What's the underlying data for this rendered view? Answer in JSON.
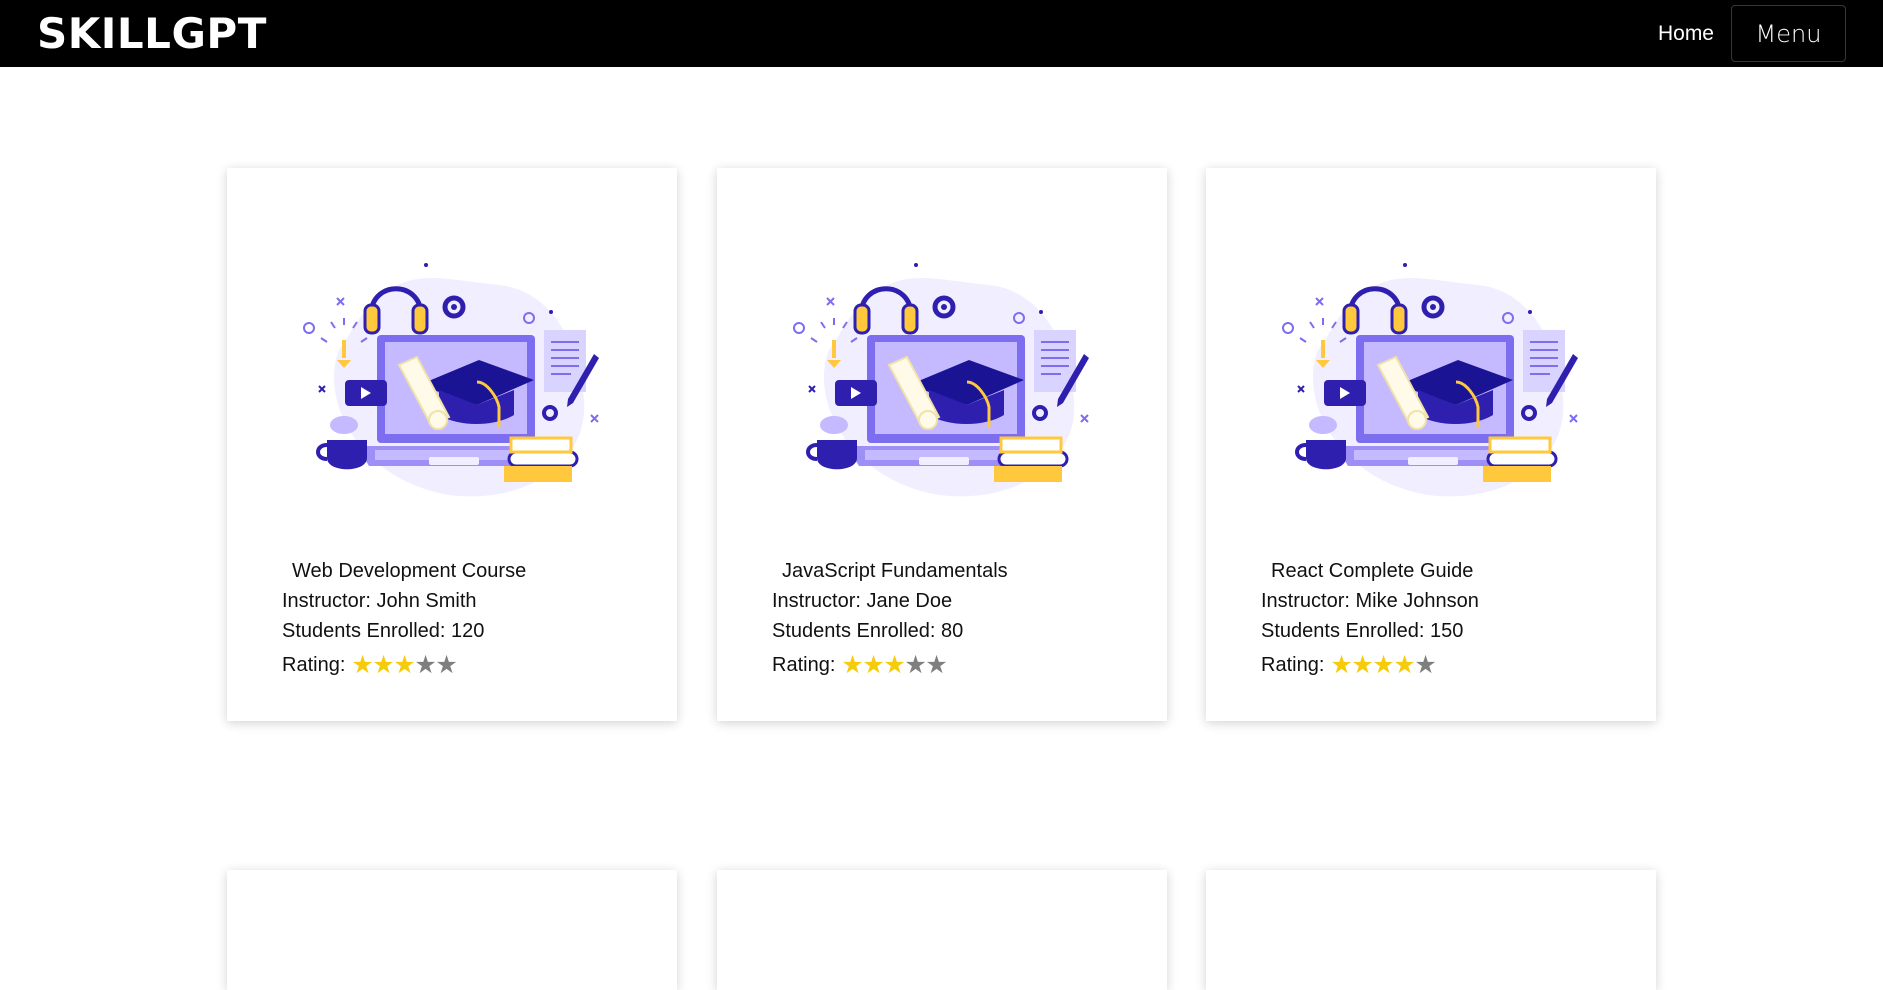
{
  "header": {
    "brand": "SKILLGPT",
    "home_label": "Home",
    "menu_label": "Menu"
  },
  "colors": {
    "navbar": "#000000",
    "star_on": "#f5cb0a",
    "star_off": "#7f7f7f",
    "illustration_primary": "#2e1fae",
    "illustration_accent": "#ffc83d"
  },
  "courses": [
    {
      "title": "Web Development Course",
      "instructor": "Instructor: John Smith",
      "students": "Students Enrolled: 120",
      "rating_label": "Rating:",
      "rating": 3,
      "rating_max": 5,
      "illustration": "online-education-icon"
    },
    {
      "title": "JavaScript Fundamentals",
      "instructor": "Instructor: Jane Doe",
      "students": "Students Enrolled: 80",
      "rating_label": "Rating:",
      "rating": 3,
      "rating_max": 5,
      "illustration": "online-education-icon"
    },
    {
      "title": "React Complete Guide",
      "instructor": "Instructor: Mike Johnson",
      "students": "Students Enrolled: 150",
      "rating_label": "Rating:",
      "rating": 4,
      "rating_max": 5,
      "illustration": "online-education-icon"
    }
  ]
}
